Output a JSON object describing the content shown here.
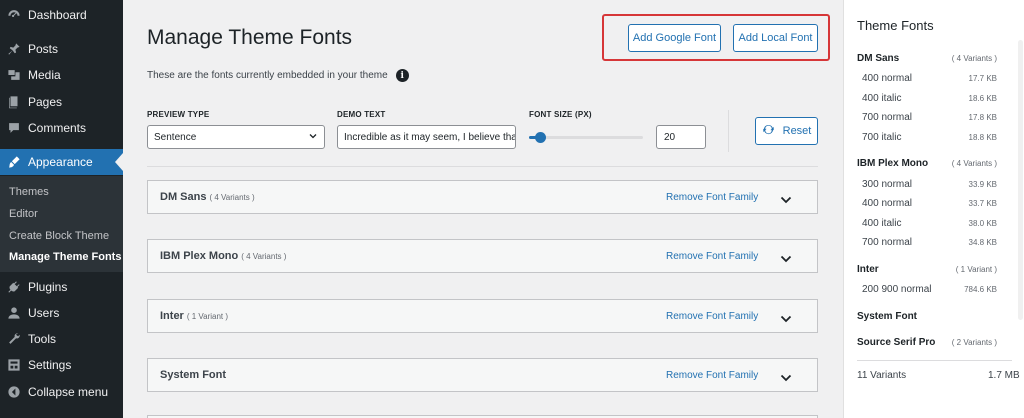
{
  "admin_menu": {
    "items": [
      {
        "label": "Dashboard",
        "icon": "dashboard-icon"
      },
      {
        "label": "Posts",
        "icon": "pin-icon"
      },
      {
        "label": "Media",
        "icon": "media-icon"
      },
      {
        "label": "Pages",
        "icon": "pages-icon"
      },
      {
        "label": "Comments",
        "icon": "comment-icon"
      },
      {
        "label": "Appearance",
        "icon": "brush-icon"
      },
      {
        "label": "Plugins",
        "icon": "plug-icon"
      },
      {
        "label": "Users",
        "icon": "user-icon"
      },
      {
        "label": "Tools",
        "icon": "wrench-icon"
      },
      {
        "label": "Settings",
        "icon": "settings-icon"
      },
      {
        "label": "Collapse menu",
        "icon": "collapse-icon"
      }
    ],
    "submenu": [
      {
        "label": "Themes"
      },
      {
        "label": "Editor"
      },
      {
        "label": "Create Block Theme"
      },
      {
        "label": "Manage Theme Fonts"
      }
    ]
  },
  "page": {
    "title": "Manage Theme Fonts",
    "intro": "These are the fonts currently embedded in your theme",
    "add_google_font": "Add Google Font",
    "add_local_font": "Add Local Font"
  },
  "controls": {
    "preview_type_label": "PREVIEW TYPE",
    "preview_type_value": "Sentence",
    "demo_text_label": "DEMO TEXT",
    "demo_text_value": "Incredible as it may seem, I believe tha",
    "font_size_label": "FONT SIZE (PX)",
    "font_size_value": "20",
    "font_size_slider_fraction": 0.1,
    "reset_label": "Reset"
  },
  "families": [
    {
      "name": "DM Sans",
      "count": "( 4 Variants )",
      "remove": "Remove Font Family"
    },
    {
      "name": "IBM Plex Mono",
      "count": "( 4 Variants )",
      "remove": "Remove Font Family"
    },
    {
      "name": "Inter",
      "count": "( 1 Variant )",
      "remove": "Remove Font Family"
    },
    {
      "name": "System Font",
      "count": "",
      "remove": "Remove Font Family"
    }
  ],
  "sidebar": {
    "title": "Theme Fonts",
    "families": [
      {
        "name": "DM Sans",
        "count": "( 4 Variants )",
        "variants": [
          {
            "name": "400 normal",
            "size": "17.7 KB"
          },
          {
            "name": "400 italic",
            "size": "18.6 KB"
          },
          {
            "name": "700 normal",
            "size": "17.8 KB"
          },
          {
            "name": "700 italic",
            "size": "18.8 KB"
          }
        ]
      },
      {
        "name": "IBM Plex Mono",
        "count": "( 4 Variants )",
        "variants": [
          {
            "name": "300 normal",
            "size": "33.9 KB"
          },
          {
            "name": "400 normal",
            "size": "33.7 KB"
          },
          {
            "name": "400 italic",
            "size": "38.0 KB"
          },
          {
            "name": "700 normal",
            "size": "34.8 KB"
          }
        ]
      },
      {
        "name": "Inter",
        "count": "( 1 Variant )",
        "variants": [
          {
            "name": "200 900 normal",
            "size": "784.6 KB"
          }
        ]
      },
      {
        "name": "System Font",
        "count": "",
        "variants": []
      },
      {
        "name": "Source Serif Pro",
        "count": "( 2 Variants )",
        "variants": []
      }
    ],
    "total_variants": "11 Variants",
    "total_size": "1.7 MB"
  },
  "colors": {
    "accent": "#2271b1",
    "admin_bg": "#1d2327",
    "highlight": "#d63638"
  }
}
